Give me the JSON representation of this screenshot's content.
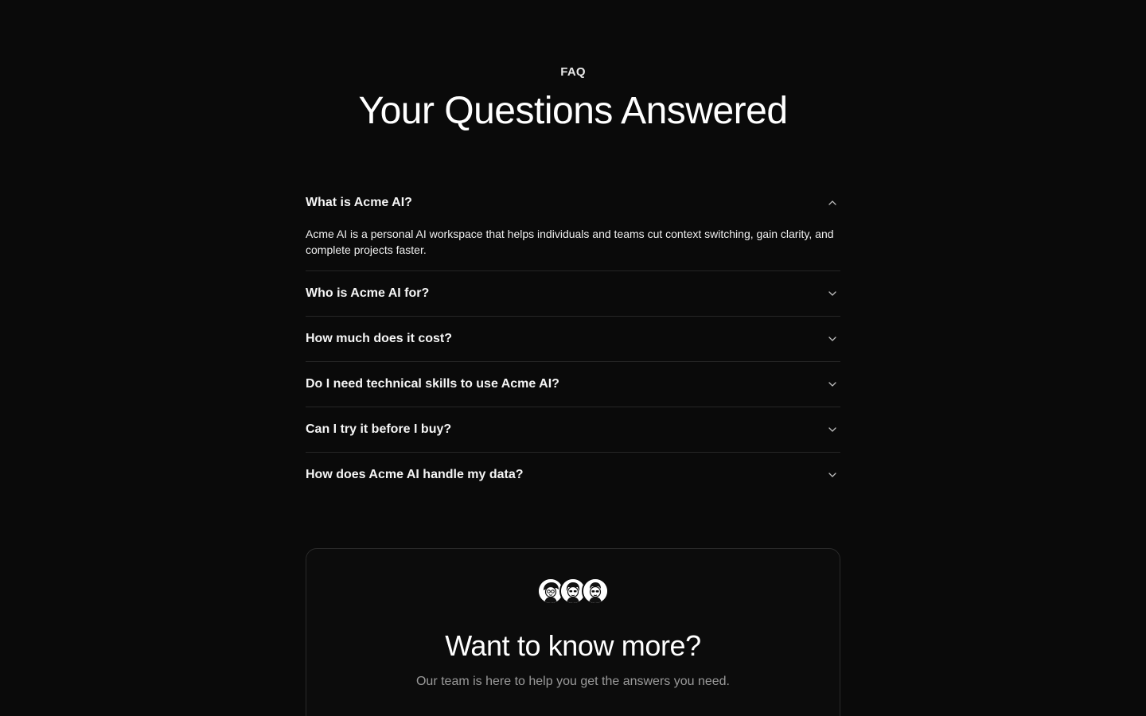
{
  "header": {
    "eyebrow": "FAQ",
    "title": "Your Questions Answered"
  },
  "faq": {
    "items": [
      {
        "question": "What is Acme AI?",
        "answer": "Acme AI is a personal AI workspace that helps individuals and teams cut context switching, gain clarity, and complete projects faster.",
        "expanded": true,
        "icon": "chevron-up-icon"
      },
      {
        "question": "Who is Acme AI for?",
        "expanded": false,
        "icon": "chevron-down-icon"
      },
      {
        "question": "How much does it cost?",
        "expanded": false,
        "icon": "chevron-down-icon"
      },
      {
        "question": "Do I need technical skills to use Acme AI?",
        "expanded": false,
        "icon": "chevron-down-icon"
      },
      {
        "question": "Can I try it before I buy?",
        "expanded": false,
        "icon": "chevron-down-icon"
      },
      {
        "question": "How does Acme AI handle my data?",
        "expanded": false,
        "icon": "chevron-down-icon"
      }
    ]
  },
  "cta": {
    "avatars": [
      "avatar-1",
      "avatar-2",
      "avatar-3"
    ],
    "title": "Want to know more?",
    "subtitle": "Our team is here to help you get the answers you need."
  },
  "colors": {
    "background": "#0a0a0a",
    "text": "#ffffff",
    "muted": "#9a9a9a",
    "divider": "#262626"
  }
}
